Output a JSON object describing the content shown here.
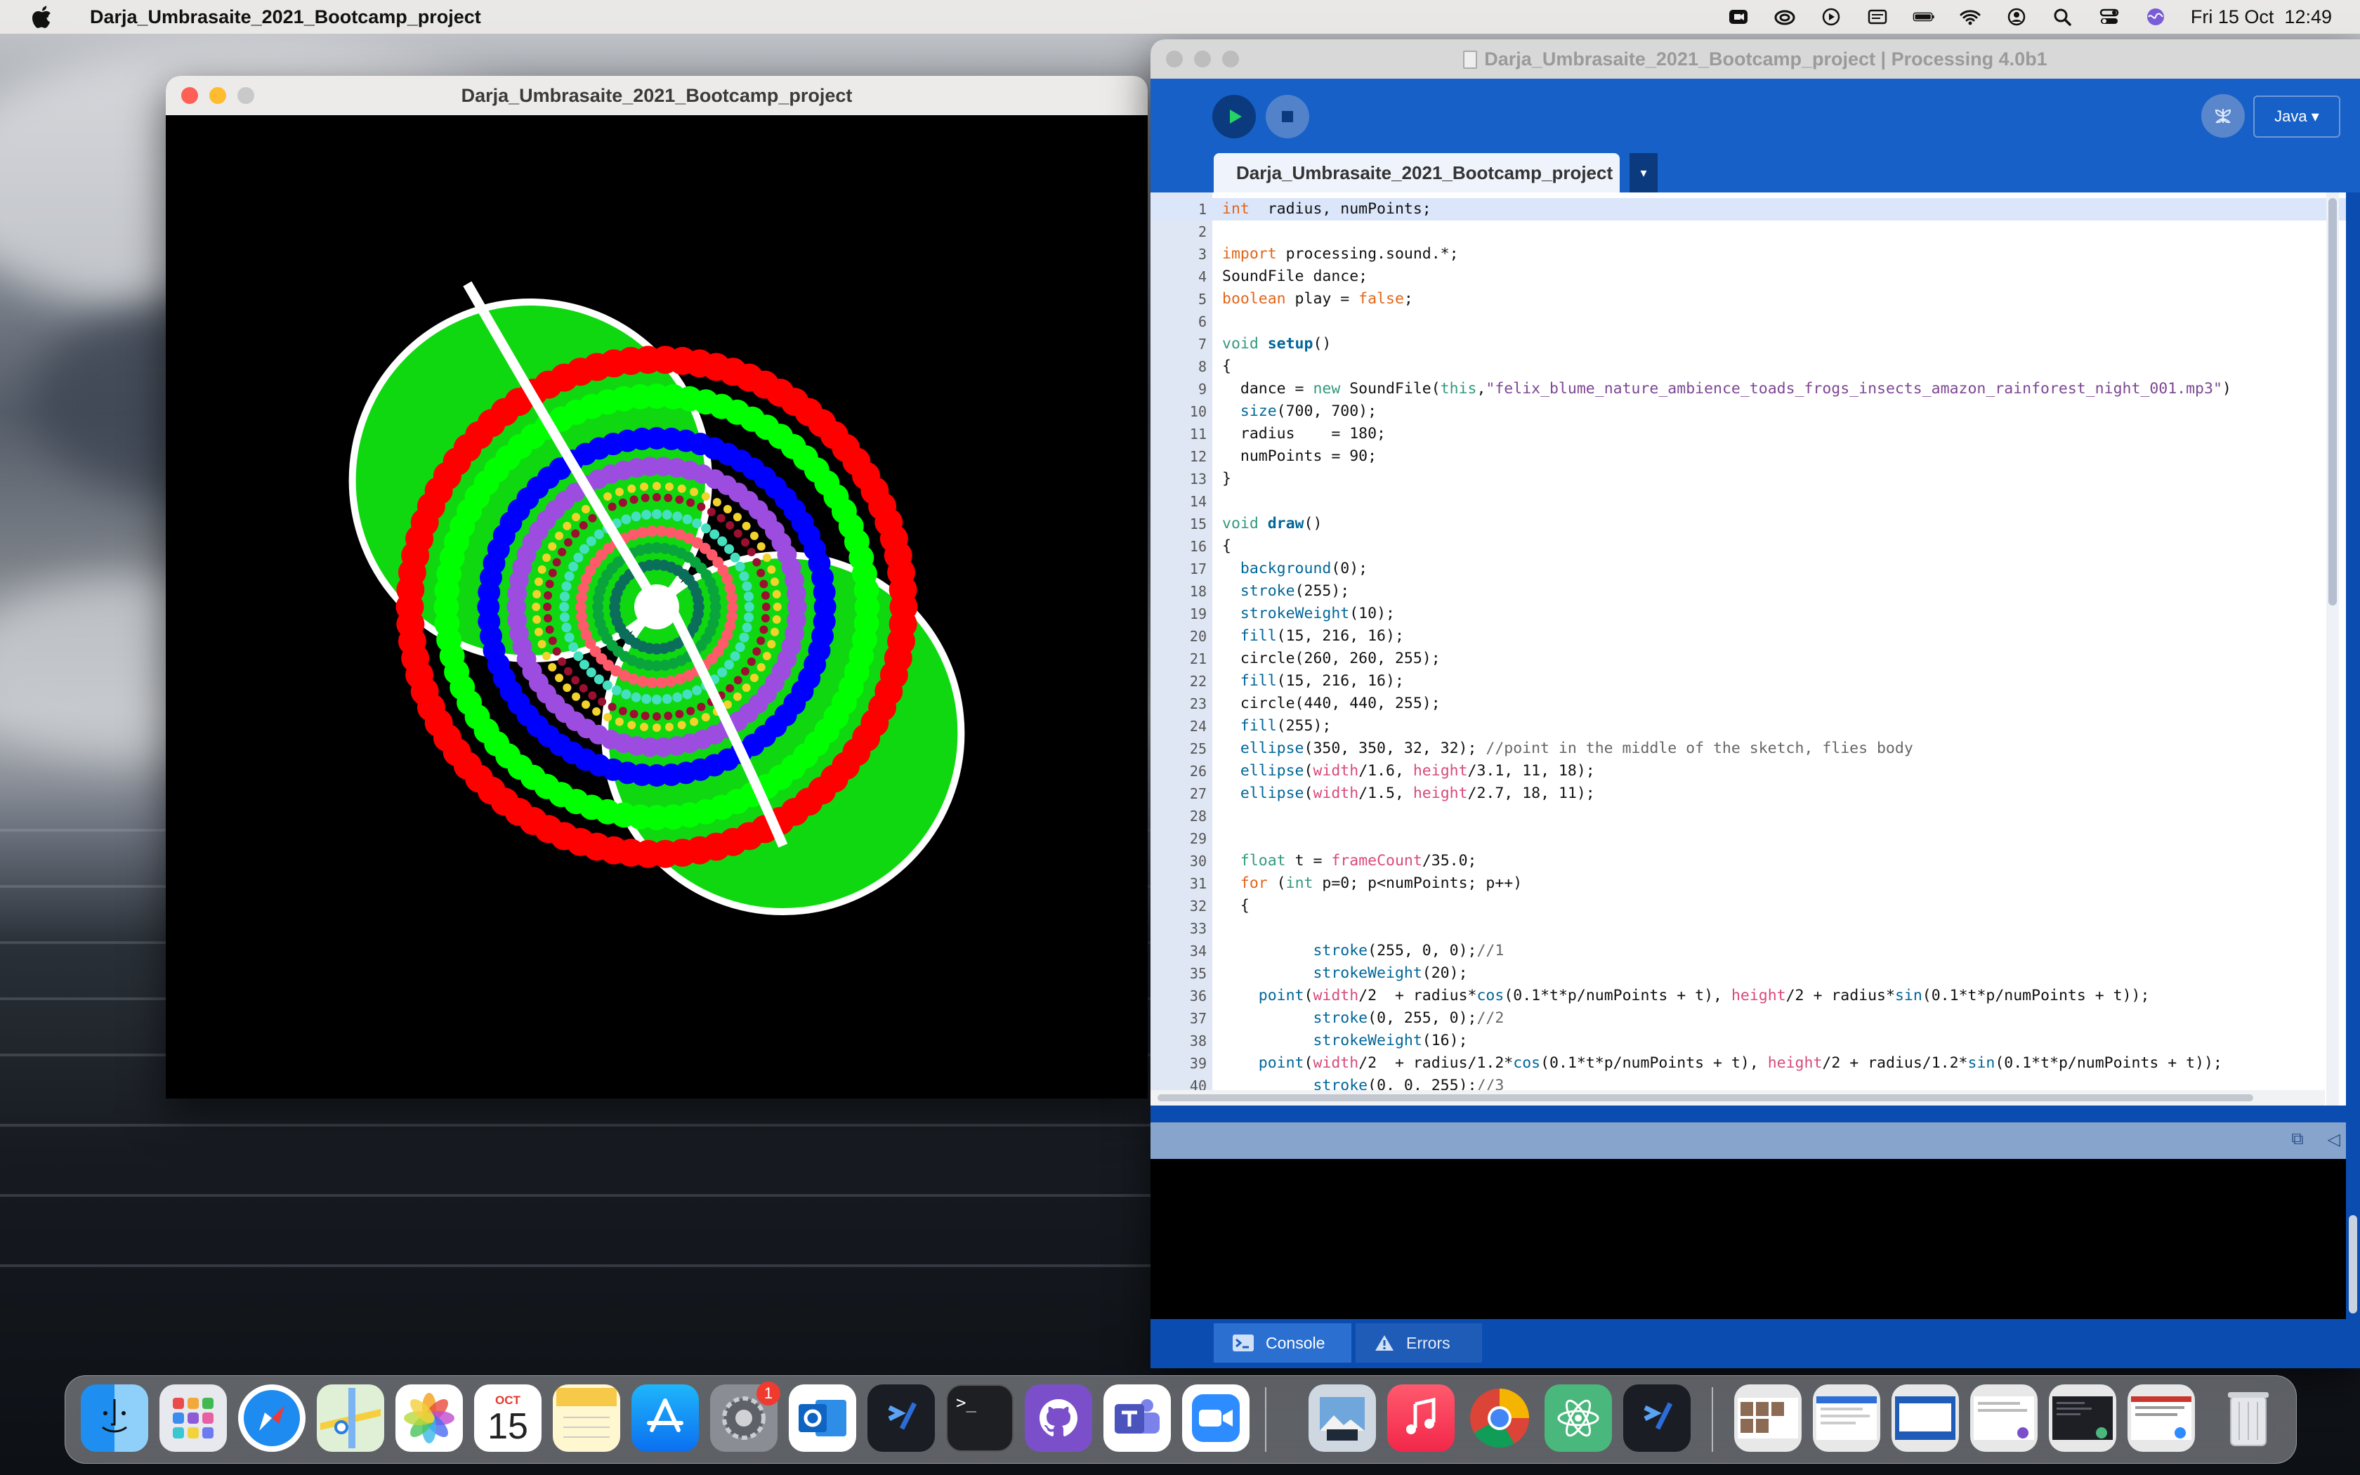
{
  "menubar": {
    "app_name": "Darja_Umbrasaite_2021_Bootcamp_project",
    "datetime": "Fri 15 Oct  12:49",
    "status_icons": [
      "camera-icon",
      "creative-cloud-icon",
      "media-play-icon",
      "display-icon",
      "battery-icon",
      "wifi-icon",
      "user-icon",
      "spotlight-search-icon",
      "control-center-icon",
      "siri-icon"
    ]
  },
  "sketch_window": {
    "title": "Darja_Umbrasaite_2021_Bootcamp_project"
  },
  "ide": {
    "title": "Darja_Umbrasaite_2021_Bootcamp_project | Processing 4.0b1",
    "run_icon": "play-icon",
    "stop_icon": "stop-icon",
    "debug_icon": "butterfly-debug-icon",
    "mode_label": "Java ▾",
    "tab_label": "Darja_Umbrasaite_2021_Bootcamp_project",
    "tab_menu_label": "▾",
    "code_lines": [
      {
        "n": "1",
        "t": [
          [
            "kw",
            "int"
          ],
          [
            "",
            "  radius, numPoints;"
          ]
        ]
      },
      {
        "n": "2",
        "t": []
      },
      {
        "n": "3",
        "t": [
          [
            "kw",
            "import"
          ],
          [
            "",
            " processing.sound.*;"
          ]
        ]
      },
      {
        "n": "4",
        "t": [
          [
            "",
            "SoundFile dance;"
          ]
        ]
      },
      {
        "n": "5",
        "t": [
          [
            "kw",
            "boolean"
          ],
          [
            "",
            " play = "
          ],
          [
            "kw",
            "false"
          ],
          [
            "",
            ";"
          ]
        ]
      },
      {
        "n": "6",
        "t": []
      },
      {
        "n": "7",
        "t": [
          [
            "ty",
            "void"
          ],
          [
            " ",
            ""
          ],
          [
            "fnb",
            " setup"
          ],
          [
            "",
            "()"
          ]
        ]
      },
      {
        "n": "8",
        "t": [
          [
            "",
            "{"
          ]
        ]
      },
      {
        "n": "9",
        "t": [
          [
            "",
            "  dance = "
          ],
          [
            "ty",
            "new"
          ],
          [
            "",
            " SoundFile("
          ],
          [
            "ty",
            "this"
          ],
          [
            "",
            ","
          ],
          [
            "st",
            "\"felix_blume_nature_ambience_toads_frogs_insects_amazon_rainforest_night_001.mp3\""
          ],
          [
            "",
            ")"
          ]
        ]
      },
      {
        "n": "10",
        "t": [
          [
            "",
            "  "
          ],
          [
            "fn",
            "size"
          ],
          [
            "",
            "(700, 700);"
          ]
        ]
      },
      {
        "n": "11",
        "t": [
          [
            "",
            "  radius    = 180;"
          ]
        ]
      },
      {
        "n": "12",
        "t": [
          [
            "",
            "  numPoints = 90;"
          ]
        ]
      },
      {
        "n": "13",
        "t": [
          [
            "",
            "}"
          ]
        ]
      },
      {
        "n": "14",
        "t": []
      },
      {
        "n": "15",
        "t": [
          [
            "ty",
            "void"
          ],
          [
            "fnb",
            " draw"
          ],
          [
            "",
            "()"
          ]
        ]
      },
      {
        "n": "16",
        "t": [
          [
            "",
            "{"
          ]
        ]
      },
      {
        "n": "17",
        "t": [
          [
            "",
            "  "
          ],
          [
            "fn",
            "background"
          ],
          [
            "",
            "(0);"
          ]
        ]
      },
      {
        "n": "18",
        "t": [
          [
            "",
            "  "
          ],
          [
            "fn",
            "stroke"
          ],
          [
            "",
            "(255);"
          ]
        ]
      },
      {
        "n": "19",
        "t": [
          [
            "",
            "  "
          ],
          [
            "fn",
            "strokeWeight"
          ],
          [
            "",
            "(10);"
          ]
        ]
      },
      {
        "n": "20",
        "t": [
          [
            "",
            "  "
          ],
          [
            "fn",
            "fill"
          ],
          [
            "",
            "(15, 216, 16);"
          ]
        ]
      },
      {
        "n": "21",
        "t": [
          [
            "",
            "  circle(260, 260, 255);"
          ]
        ]
      },
      {
        "n": "22",
        "t": [
          [
            "",
            "  "
          ],
          [
            "fn",
            "fill"
          ],
          [
            "",
            "(15, 216, 16);"
          ]
        ]
      },
      {
        "n": "23",
        "t": [
          [
            "",
            "  circle(440, 440, 255);"
          ]
        ]
      },
      {
        "n": "24",
        "t": [
          [
            "",
            "  "
          ],
          [
            "fn",
            "fill"
          ],
          [
            "",
            "(255);"
          ]
        ]
      },
      {
        "n": "25",
        "t": [
          [
            "",
            "  "
          ],
          [
            "fn",
            "ellipse"
          ],
          [
            "",
            "(350, 350, 32, 32); "
          ],
          [
            "cm",
            "//point in the middle of the sketch, flies body"
          ]
        ]
      },
      {
        "n": "26",
        "t": [
          [
            "",
            "  "
          ],
          [
            "fn",
            "ellipse"
          ],
          [
            "",
            "("
          ],
          [
            "cn",
            "width"
          ],
          [
            "",
            "/1.6, "
          ],
          [
            "cn",
            "height"
          ],
          [
            "",
            "/3.1, 11, 18);"
          ]
        ]
      },
      {
        "n": "27",
        "t": [
          [
            "",
            "  "
          ],
          [
            "fn",
            "ellipse"
          ],
          [
            "",
            "("
          ],
          [
            "cn",
            "width"
          ],
          [
            "",
            "/1.5, "
          ],
          [
            "cn",
            "height"
          ],
          [
            "",
            "/2.7, 18, 11);"
          ]
        ]
      },
      {
        "n": "28",
        "t": []
      },
      {
        "n": "29",
        "t": []
      },
      {
        "n": "30",
        "t": [
          [
            "",
            "  "
          ],
          [
            "ty",
            "float"
          ],
          [
            "",
            " t = "
          ],
          [
            "cn",
            "frameCount"
          ],
          [
            "",
            "/35.0;"
          ]
        ]
      },
      {
        "n": "31",
        "t": [
          [
            "",
            "  "
          ],
          [
            "kw",
            "for"
          ],
          [
            "",
            " ("
          ],
          [
            "ty",
            "int"
          ],
          [
            "",
            " p=0; p<numPoints; p++)"
          ]
        ]
      },
      {
        "n": "32",
        "t": [
          [
            "",
            "  {"
          ]
        ]
      },
      {
        "n": "33",
        "t": []
      },
      {
        "n": "34",
        "t": [
          [
            "",
            "          "
          ],
          [
            "fn",
            "stroke"
          ],
          [
            "",
            "(255, 0, 0);"
          ],
          [
            "cm",
            "//1"
          ]
        ]
      },
      {
        "n": "35",
        "t": [
          [
            "",
            "          "
          ],
          [
            "fn",
            "strokeWeight"
          ],
          [
            "",
            "(20);"
          ]
        ]
      },
      {
        "n": "36",
        "t": [
          [
            "",
            "    "
          ],
          [
            "fn",
            "point"
          ],
          [
            "",
            "("
          ],
          [
            "cn",
            "width"
          ],
          [
            "",
            "/2  + radius*"
          ],
          [
            "fn",
            "cos"
          ],
          [
            "",
            "(0.1*t*p/numPoints + t), "
          ],
          [
            "cn",
            "height"
          ],
          [
            "",
            "/2 + radius*"
          ],
          [
            "fn",
            "sin"
          ],
          [
            "",
            "(0.1*t*p/numPoints + t));"
          ]
        ]
      },
      {
        "n": "37",
        "t": [
          [
            "",
            "          "
          ],
          [
            "fn",
            "stroke"
          ],
          [
            "",
            "(0, 255, 0);"
          ],
          [
            "cm",
            "//2"
          ]
        ]
      },
      {
        "n": "38",
        "t": [
          [
            "",
            "          "
          ],
          [
            "fn",
            "strokeWeight"
          ],
          [
            "",
            "(16);"
          ]
        ]
      },
      {
        "n": "39",
        "t": [
          [
            "",
            "    "
          ],
          [
            "fn",
            "point"
          ],
          [
            "",
            "("
          ],
          [
            "cn",
            "width"
          ],
          [
            "",
            "/2  + radius/1.2*"
          ],
          [
            "fn",
            "cos"
          ],
          [
            "",
            "(0.1*t*p/numPoints + t), "
          ],
          [
            "cn",
            "height"
          ],
          [
            "",
            "/2 + radius/1.2*"
          ],
          [
            "fn",
            "sin"
          ],
          [
            "",
            "(0.1*t*p/numPoints + t));"
          ]
        ]
      },
      {
        "n": "40",
        "t": [
          [
            "",
            "          "
          ],
          [
            "fn",
            "stroke"
          ],
          [
            "",
            "(0, 0, 255);"
          ],
          [
            "cm",
            "//3"
          ]
        ]
      }
    ],
    "console_tab": "Console",
    "errors_tab": "Errors",
    "console_icon": "console-icon",
    "errors_icon": "warning-icon"
  },
  "dock": {
    "apps": [
      "finder-icon",
      "launchpad-icon",
      "safari-icon",
      "maps-icon",
      "photos-icon",
      "calendar-icon",
      "notes-icon",
      "app-store-icon",
      "system-preferences-icon",
      "outlook-icon",
      "processing-icon",
      "terminal-icon",
      "github-desktop-icon",
      "teams-icon",
      "zoom-icon",
      "preview-icon",
      "music-icon",
      "chrome-icon",
      "atom-icon",
      "processing-icon-2"
    ],
    "calendar_month": "OCT",
    "calendar_day": "15",
    "settings_badge": "1",
    "recent_windows": [
      "window-thumb-1",
      "window-thumb-2",
      "window-thumb-3",
      "window-thumb-4",
      "window-thumb-5",
      "window-thumb-6"
    ],
    "trash": "trash-icon"
  },
  "colors": {
    "ide_blue": "#0b4cb0",
    "toolbar_blue": "#1660c7",
    "sketch_green": "#0fd810",
    "ring_red": "#ff0000",
    "ring_green": "#00ff00",
    "ring_blue": "#0000ff"
  }
}
